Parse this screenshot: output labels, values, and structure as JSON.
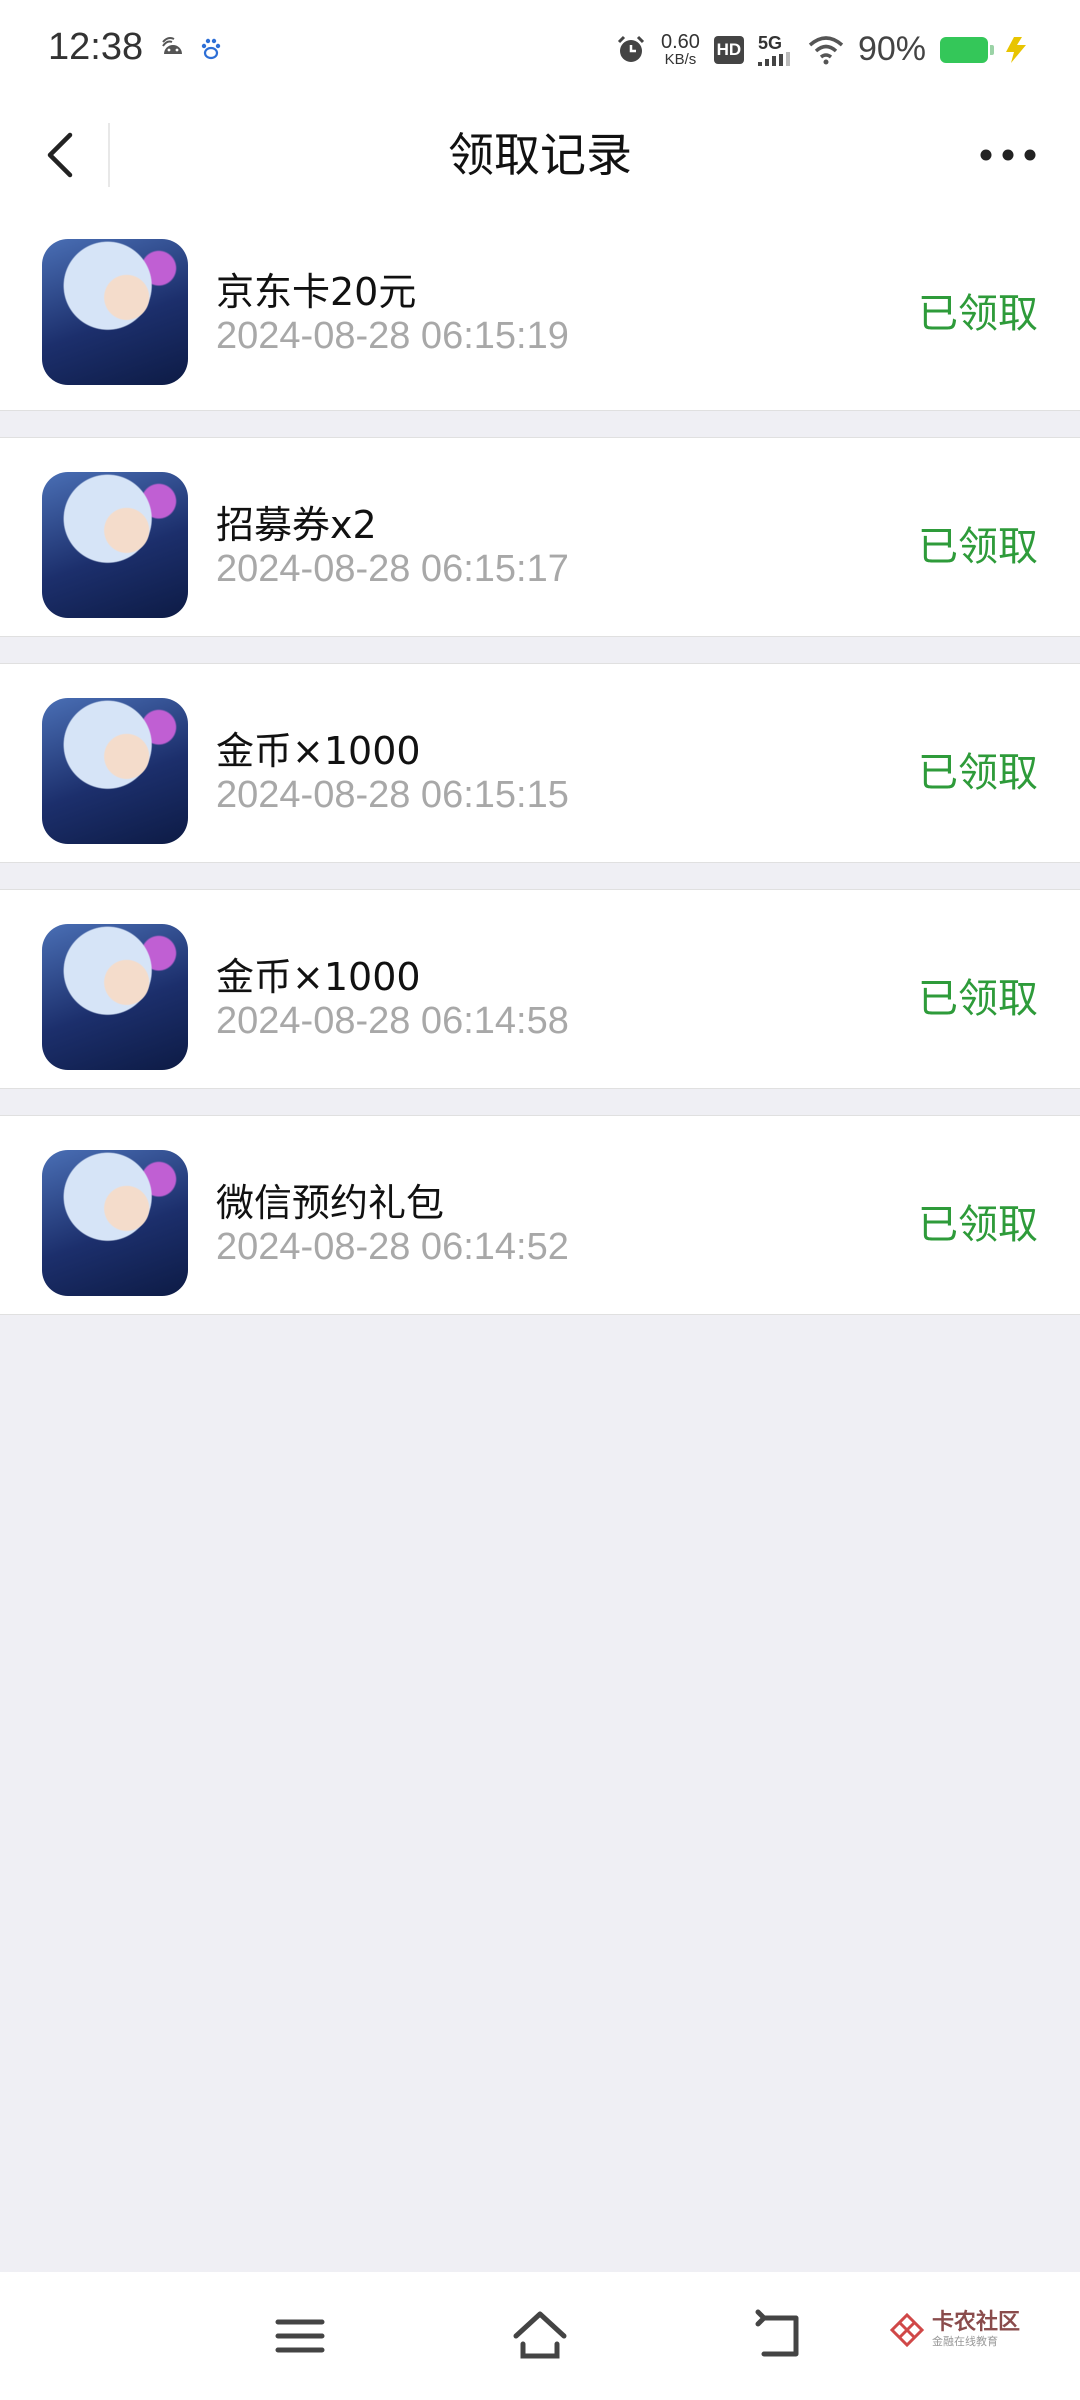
{
  "status_bar": {
    "time": "12:38",
    "net_speed_value": "0.60",
    "net_speed_unit": "KB/s",
    "hd_badge": "HD",
    "network_type": "5G",
    "battery_percent": "90%",
    "icons": [
      "android-icon",
      "paw-icon",
      "alarm-icon",
      "signal-icon",
      "wifi-icon",
      "battery-icon",
      "charging-icon"
    ]
  },
  "nav": {
    "title": "领取记录",
    "back_icon": "chevron-left-icon",
    "more_icon": "more-dots-icon"
  },
  "records": [
    {
      "title": "京东卡20元",
      "time": "2024-08-28 06:15:19",
      "status": "已领取"
    },
    {
      "title": "招募券x2",
      "time": "2024-08-28 06:15:17",
      "status": "已领取"
    },
    {
      "title": "金币×1000",
      "time": "2024-08-28 06:15:15",
      "status": "已领取"
    },
    {
      "title": "金币×1000",
      "time": "2024-08-28 06:14:58",
      "status": "已领取"
    },
    {
      "title": "微信预约礼包",
      "time": "2024-08-28 06:14:52",
      "status": "已领取"
    }
  ],
  "system_nav": {
    "icons": [
      "menu-icon",
      "home-icon",
      "back-icon"
    ]
  },
  "watermark": {
    "text": "卡农社区",
    "subtext": "金融在线教育"
  },
  "colors": {
    "accent_green": "#2e9b3a",
    "background": "#efeff4",
    "battery_green": "#34c759"
  }
}
